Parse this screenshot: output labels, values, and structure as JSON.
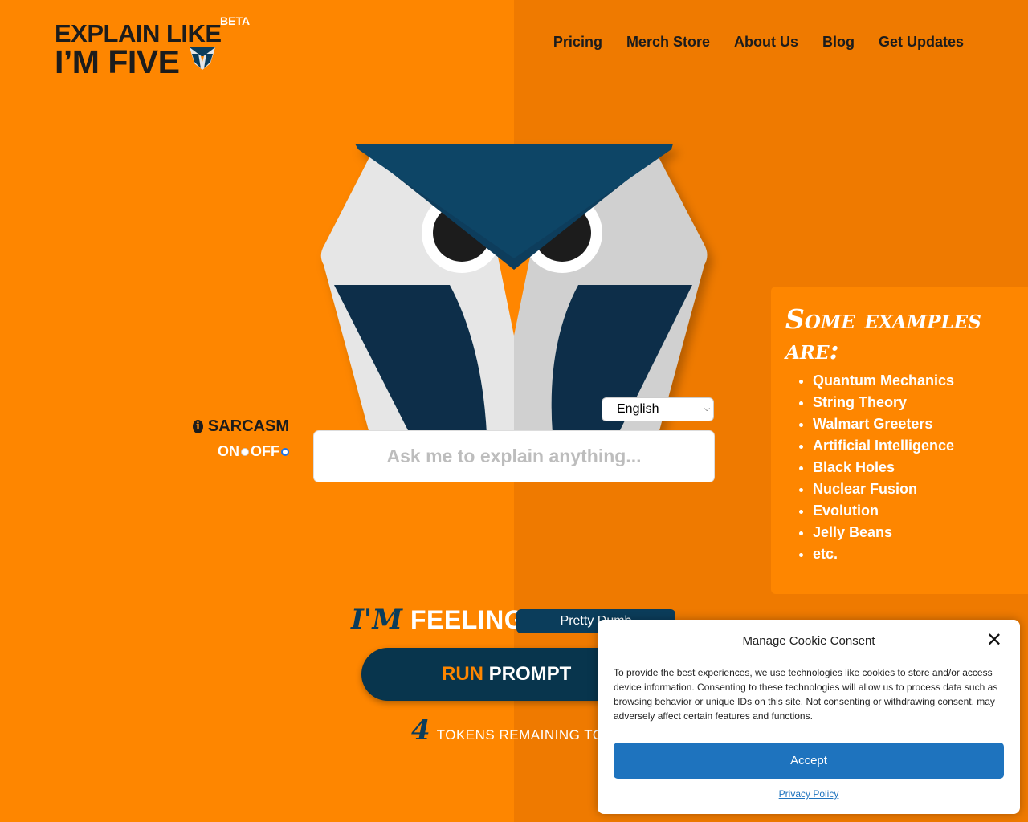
{
  "brand": {
    "line1": "EXPLAIN LIKE",
    "line2": "I’M FIVE",
    "badge": "BETA"
  },
  "nav": {
    "items": [
      "Pricing",
      "Merch Store",
      "About Us",
      "Blog",
      "Get Updates"
    ]
  },
  "examples": {
    "heading": "Some examples are:",
    "items": [
      "Quantum Mechanics",
      "String Theory",
      "Walmart Greeters",
      "Artificial Intelligence",
      "Black Holes",
      "Nuclear Fusion",
      "Evolution",
      "Jelly Beans",
      "etc."
    ]
  },
  "sarcasm": {
    "label": "SARCASM",
    "on_label": "ON",
    "off_label": "OFF",
    "selected": "OFF"
  },
  "language": {
    "selected": "English"
  },
  "prompt": {
    "placeholder": "Ask me to explain anything..."
  },
  "feeling": {
    "im": "I'M",
    "word": "FEELING",
    "mood_selected": "Pretty Dumb"
  },
  "run_button": {
    "run": "RUN",
    "prompt": "PROMPT",
    "arrow": "›"
  },
  "tokens": {
    "count": "4",
    "text": "TOKENS REMAINING TODAY"
  },
  "cookie": {
    "title": "Manage Cookie Consent",
    "close": "✕",
    "body": "To provide the best experiences, we use technologies like cookies to store and/or access device information. Consenting to these technologies will allow us to process data such as browsing behavior or unique IDs on this site. Not consenting or withdrawing consent, may adversely affect certain features and functions.",
    "accept": "Accept",
    "policy": "Privacy Policy"
  },
  "colors": {
    "orange_left": "#fe8600",
    "orange_right": "#ef7a00",
    "navy": "#0b3d5b",
    "accept_blue": "#1e73be"
  }
}
